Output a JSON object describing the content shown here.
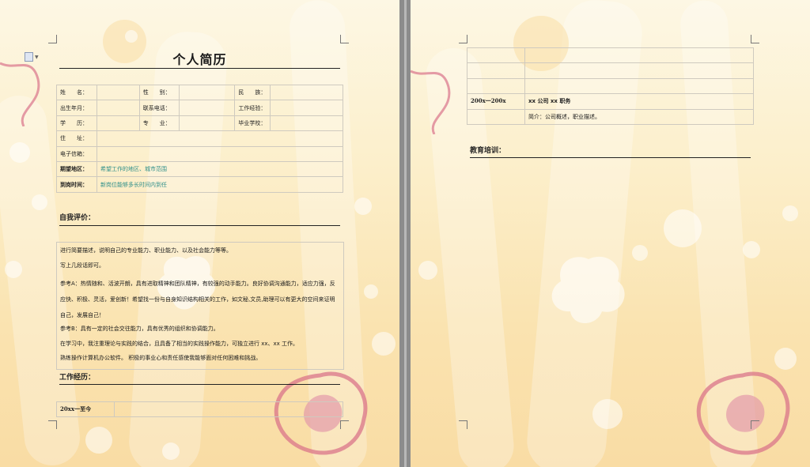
{
  "left_page": {
    "title": "个人简历",
    "info_rows": [
      [
        "姓　　名：",
        "",
        "性　　别：",
        "",
        "民　　族：",
        ""
      ],
      [
        "出生年月：",
        "",
        "联系电话：",
        "",
        "工作经验：",
        ""
      ],
      [
        "学　　历：",
        "",
        "专　　业：",
        "",
        "毕业学校：",
        ""
      ],
      [
        "住　　址：",
        ""
      ],
      [
        "电子信箱：",
        ""
      ]
    ],
    "expect_rows": [
      [
        "期望地区：",
        "希望工作的地区、城市范围"
      ],
      [
        "到岗时间：",
        "新岗位能够多长时间内到任"
      ]
    ],
    "self_eval_heading": "自我评价：",
    "self_eval_lines": [
      "进行简要描述，说明自己的专业能力、职业能力、以及社会能力等等。",
      "写上几段话即可。",
      "参考A：热情随和、活波开朗，具有进取精神和团队精神，有较强的动手能力。良好协调沟通能力，适应力强，反应快、积极、灵活，爱创新！希望找一份与自身知识结构相关的工作，如文秘,文员,助理可以有更大的空间来证明自己，发展自己！",
      "参考B：具有一定的社会交往能力，具有优秀的组织和协调能力。",
      "在学习中，我注重理论与实践的结合，且具备了相当的实践操作能力，可独立进行 xx、xx 工作。",
      "熟练操作计算机办公软件。 积极的事业心和责任感使我能够面对任何困难和挑战。"
    ],
    "work_heading": "工作经历：",
    "work_first_period": "20xx一至今"
  },
  "right_page": {
    "work_period": "200x一200x",
    "work_company": "xx 公司 xx 职务",
    "work_desc": "简介：公司概述，职业描述。",
    "education_heading": "教育培训："
  },
  "colors": {
    "teal_text": "#2f8f8a",
    "page_bg_top": "#fdf7e4",
    "page_bg_bottom": "#f9dca4",
    "rose": "#d9748a"
  }
}
